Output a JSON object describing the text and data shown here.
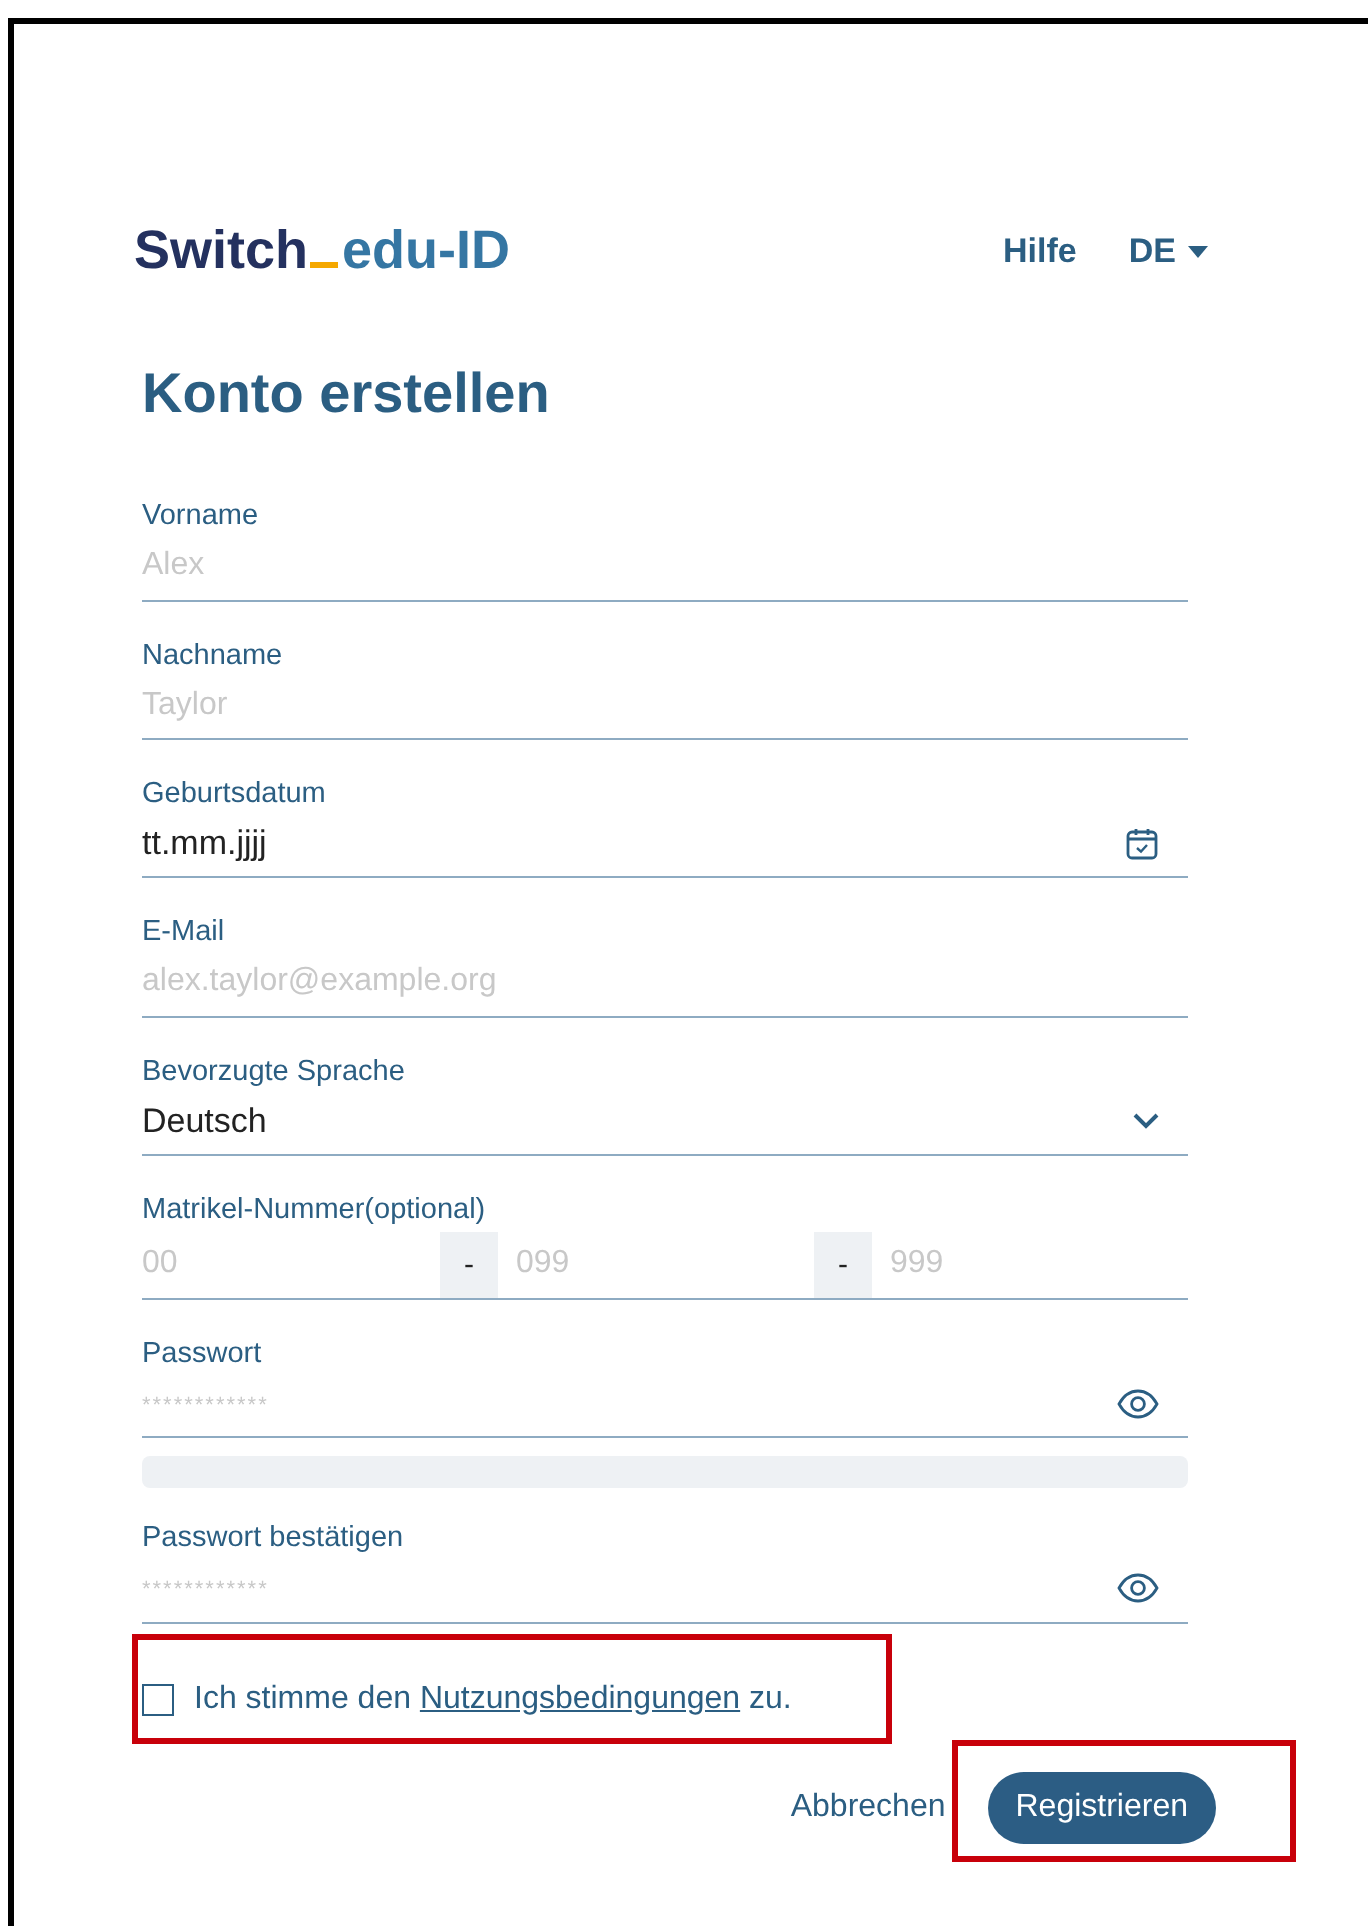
{
  "header": {
    "logo": {
      "part_1": "Switch",
      "part_2": "edu-ID"
    },
    "help_link": "Hilfe",
    "language_menu": "DE"
  },
  "title": "Konto erstellen",
  "fields": [
    {
      "kind": "text",
      "label": "Vorname",
      "placeholder": "Alex"
    },
    {
      "kind": "text",
      "label": "Nachname",
      "placeholder": "Taylor"
    },
    {
      "kind": "date",
      "label": "Geburtsdatum",
      "value": "tt.mm.jjjj"
    },
    {
      "kind": "text",
      "label": "E-Mail",
      "placeholder": "alex.taylor@example.org"
    },
    {
      "kind": "select",
      "label": "Bevorzugte Sprache",
      "value": "Deutsch"
    },
    {
      "kind": "segmented",
      "label": "Matrikel-Nummer(optional)",
      "segments": [
        {
          "placeholder": "00"
        },
        {
          "separator": "-",
          "placeholder": "099"
        },
        {
          "separator": "-",
          "placeholder": "999"
        }
      ]
    },
    {
      "kind": "password",
      "label": "Passwort",
      "placeholder": "************",
      "strength_meter": {
        "level": 0
      }
    },
    {
      "kind": "password",
      "label": "Passwort bestätigen",
      "placeholder": "************"
    }
  ],
  "terms": {
    "checked": false,
    "highlighted": true,
    "text_before": "Ich stimme den",
    "link": "Nutzungsbedingungen",
    "text_after": "zu."
  },
  "buttons": [
    {
      "kind": "link",
      "label": "Abbrechen",
      "highlighted": false
    },
    {
      "kind": "primary",
      "label": "Registrieren",
      "highlighted": true
    }
  ]
}
